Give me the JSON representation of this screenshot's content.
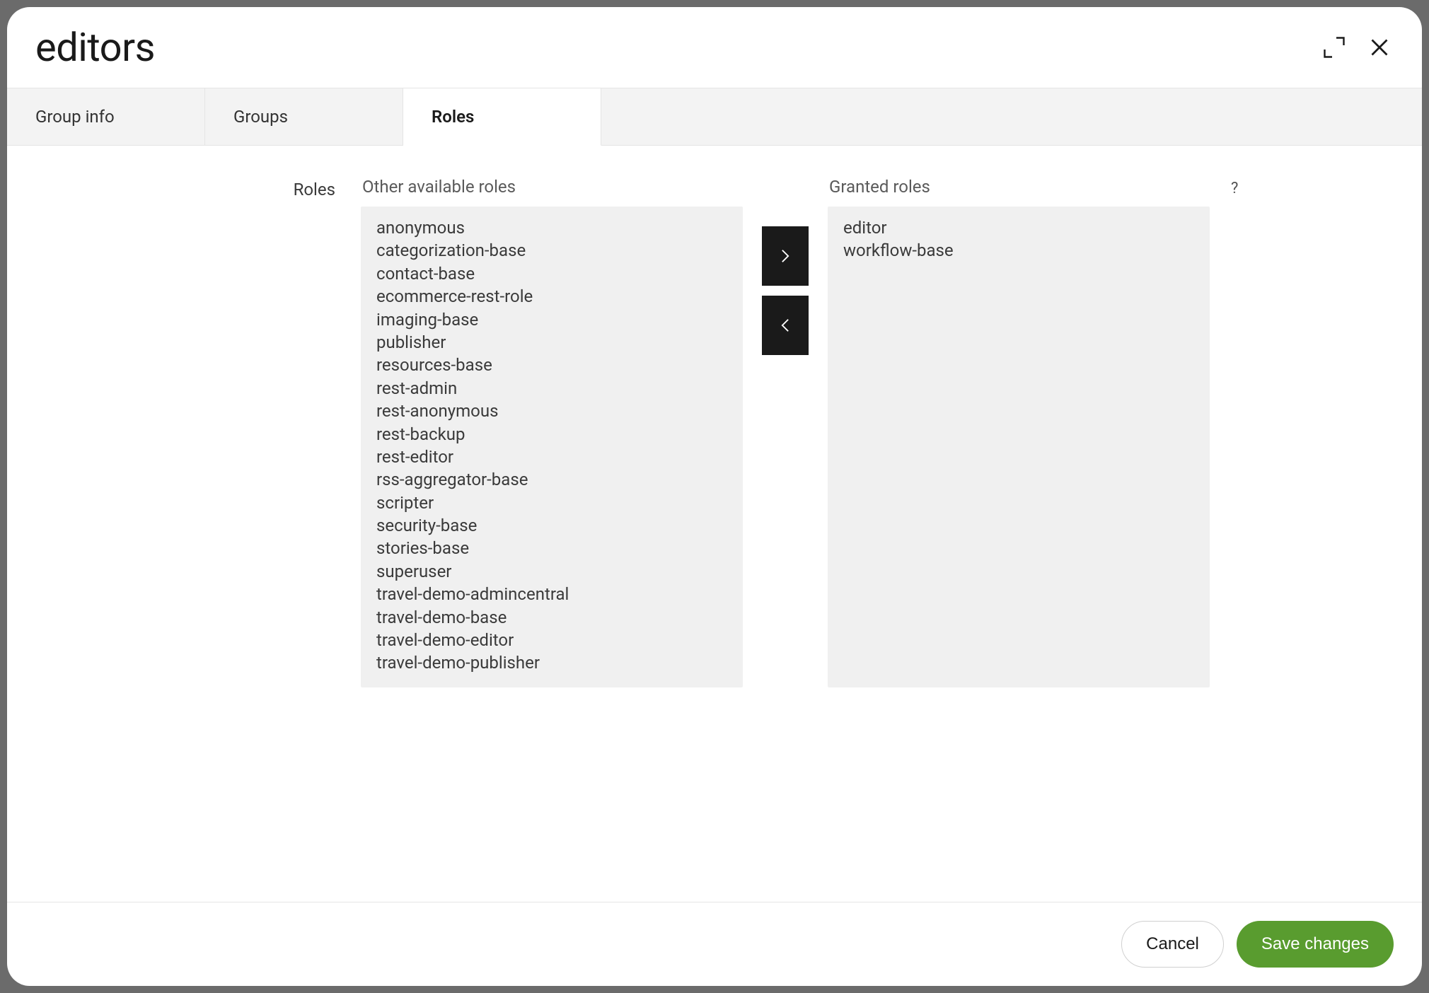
{
  "dialog": {
    "title": "editors"
  },
  "tabs": [
    {
      "label": "Group info"
    },
    {
      "label": "Groups"
    },
    {
      "label": "Roles"
    }
  ],
  "section_label": "Roles",
  "available": {
    "header": "Other available roles",
    "items": [
      "anonymous",
      "categorization-base",
      "contact-base",
      "ecommerce-rest-role",
      "imaging-base",
      "publisher",
      "resources-base",
      "rest-admin",
      "rest-anonymous",
      "rest-backup",
      "rest-editor",
      "rss-aggregator-base",
      "scripter",
      "security-base",
      "stories-base",
      "superuser",
      "travel-demo-admincentral",
      "travel-demo-base",
      "travel-demo-editor",
      "travel-demo-publisher"
    ]
  },
  "granted": {
    "header": "Granted roles",
    "items": [
      "editor",
      "workflow-base"
    ]
  },
  "help": "?",
  "footer": {
    "cancel": "Cancel",
    "save": "Save changes"
  }
}
